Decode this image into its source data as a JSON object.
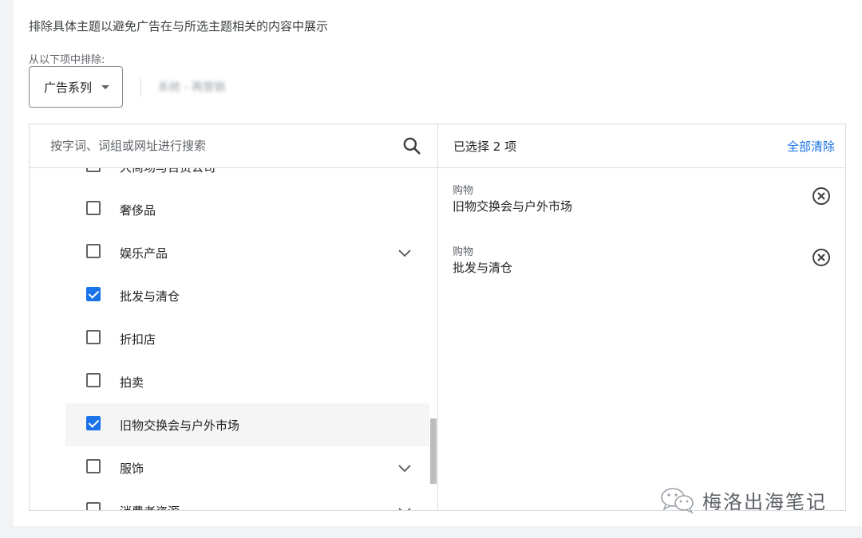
{
  "header": {
    "description": "排除具体主题以避免广告在与所选主题相关的内容中展示",
    "exclude_from_label": "从以下项中排除:",
    "level_dropdown": "广告系列",
    "campaign_name": "系统 - 再营销"
  },
  "search": {
    "placeholder": "按字词、词组或网址进行搜索",
    "icon": "search-icon"
  },
  "topics": [
    {
      "label": "大商场与百货公司",
      "checked": false,
      "expandable": false
    },
    {
      "label": "奢侈品",
      "checked": false,
      "expandable": false
    },
    {
      "label": "娱乐产品",
      "checked": false,
      "expandable": true
    },
    {
      "label": "批发与清仓",
      "checked": true,
      "expandable": false
    },
    {
      "label": "折扣店",
      "checked": false,
      "expandable": false
    },
    {
      "label": "拍卖",
      "checked": false,
      "expandable": false
    },
    {
      "label": "旧物交换会与户外市场",
      "checked": true,
      "expandable": false,
      "highlighted": true
    },
    {
      "label": "服饰",
      "checked": false,
      "expandable": true
    },
    {
      "label": "消费者资源",
      "checked": false,
      "expandable": true
    }
  ],
  "selected_panel": {
    "count_label": "已选择 2 项",
    "clear_all": "全部清除",
    "items": [
      {
        "category": "购物",
        "name": "旧物交换会与户外市场"
      },
      {
        "category": "购物",
        "name": "批发与清仓"
      }
    ]
  },
  "watermark": {
    "text": "梅洛出海笔记"
  },
  "colors": {
    "accent": "#1a73e8",
    "border": "#dadce0",
    "background": "#f1f3f4"
  }
}
